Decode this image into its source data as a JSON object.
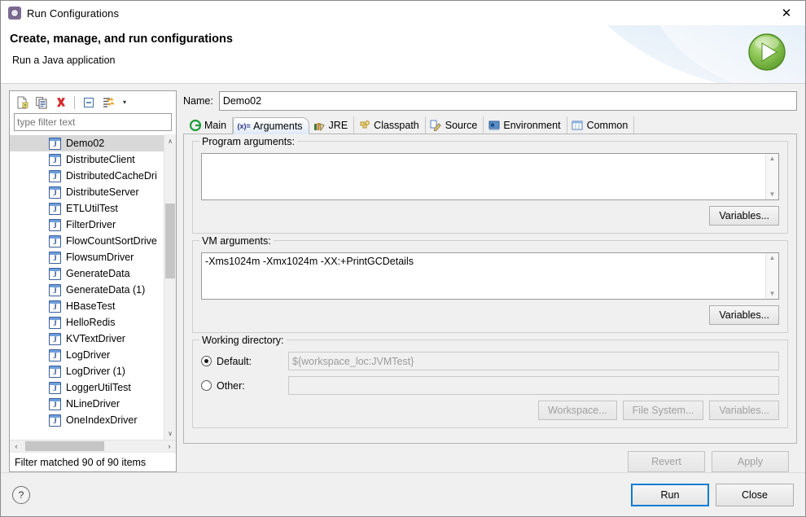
{
  "window": {
    "title": "Run Configurations",
    "app_icon": "run-config-gear-icon",
    "close_label": "✕"
  },
  "banner": {
    "heading": "Create, manage, and run configurations",
    "subheading": "Run a Java application",
    "badge_icon": "green-run-play-icon"
  },
  "left_panel": {
    "toolbar": [
      {
        "name": "new-configuration-icon",
        "label": ""
      },
      {
        "name": "duplicate-configuration-icon",
        "label": ""
      },
      {
        "name": "delete-configuration-icon",
        "label": ""
      },
      {
        "name": "collapse-all-icon",
        "label": ""
      },
      {
        "name": "filter-configurations-icon",
        "label": ""
      }
    ],
    "toolbar_caret": "▾",
    "filter": {
      "value": "",
      "placeholder": "type filter text"
    },
    "tree_items": [
      {
        "label": "Demo02",
        "selected": true
      },
      {
        "label": "DistributeClient",
        "selected": false
      },
      {
        "label": "DistributedCacheDri",
        "selected": false
      },
      {
        "label": "DistributeServer",
        "selected": false
      },
      {
        "label": "ETLUtilTest",
        "selected": false
      },
      {
        "label": "FilterDriver",
        "selected": false
      },
      {
        "label": "FlowCountSortDrive",
        "selected": false
      },
      {
        "label": "FlowsumDriver",
        "selected": false
      },
      {
        "label": "GenerateData",
        "selected": false
      },
      {
        "label": "GenerateData (1)",
        "selected": false
      },
      {
        "label": "HBaseTest",
        "selected": false
      },
      {
        "label": "HelloRedis",
        "selected": false
      },
      {
        "label": "KVTextDriver",
        "selected": false
      },
      {
        "label": "LogDriver",
        "selected": false
      },
      {
        "label": "LogDriver (1)",
        "selected": false
      },
      {
        "label": "LoggerUtilTest",
        "selected": false
      },
      {
        "label": "NLineDriver",
        "selected": false
      },
      {
        "label": "OneIndexDriver",
        "selected": false
      }
    ],
    "scroll_up": "∧",
    "scroll_down": "∨",
    "scroll_left": "‹",
    "scroll_right": "›",
    "status": "Filter matched 90 of 90 items"
  },
  "right_panel": {
    "name_label": "Name:",
    "name_value": "Demo02",
    "tabs": [
      {
        "label": "Main",
        "icon": "main-green-circle-icon",
        "active": false
      },
      {
        "label": "Arguments",
        "icon": "arguments-variable-icon",
        "active": true
      },
      {
        "label": "JRE",
        "icon": "jre-books-icon",
        "active": false
      },
      {
        "label": "Classpath",
        "icon": "classpath-puzzle-icon",
        "active": false
      },
      {
        "label": "Source",
        "icon": "source-pencil-icon",
        "active": false
      },
      {
        "label": "Environment",
        "icon": "environment-monitor-icon",
        "active": false
      },
      {
        "label": "Common",
        "icon": "common-window-icon",
        "active": false
      }
    ],
    "program_arguments": {
      "group_label": "Program arguments:",
      "value": "",
      "variables_button": "Variables..."
    },
    "vm_arguments": {
      "group_label": "VM arguments:",
      "value": "-Xms1024m -Xmx1024m -XX:+PrintGCDetails",
      "variables_button": "Variables..."
    },
    "working_directory": {
      "group_label": "Working directory:",
      "default_label": "Default:",
      "default_selected": true,
      "default_value": "${workspace_loc:JVMTest}",
      "other_label": "Other:",
      "other_selected": false,
      "other_value": "",
      "buttons": [
        {
          "label": "Workspace...",
          "disabled": true
        },
        {
          "label": "File System...",
          "disabled": true
        },
        {
          "label": "Variables...",
          "disabled": true
        }
      ]
    },
    "revert_button": {
      "label": "Revert",
      "disabled": true
    },
    "apply_button": {
      "label": "Apply",
      "disabled": true
    }
  },
  "footer": {
    "help_icon": "?",
    "run_button": "Run",
    "close_button": "Close"
  }
}
